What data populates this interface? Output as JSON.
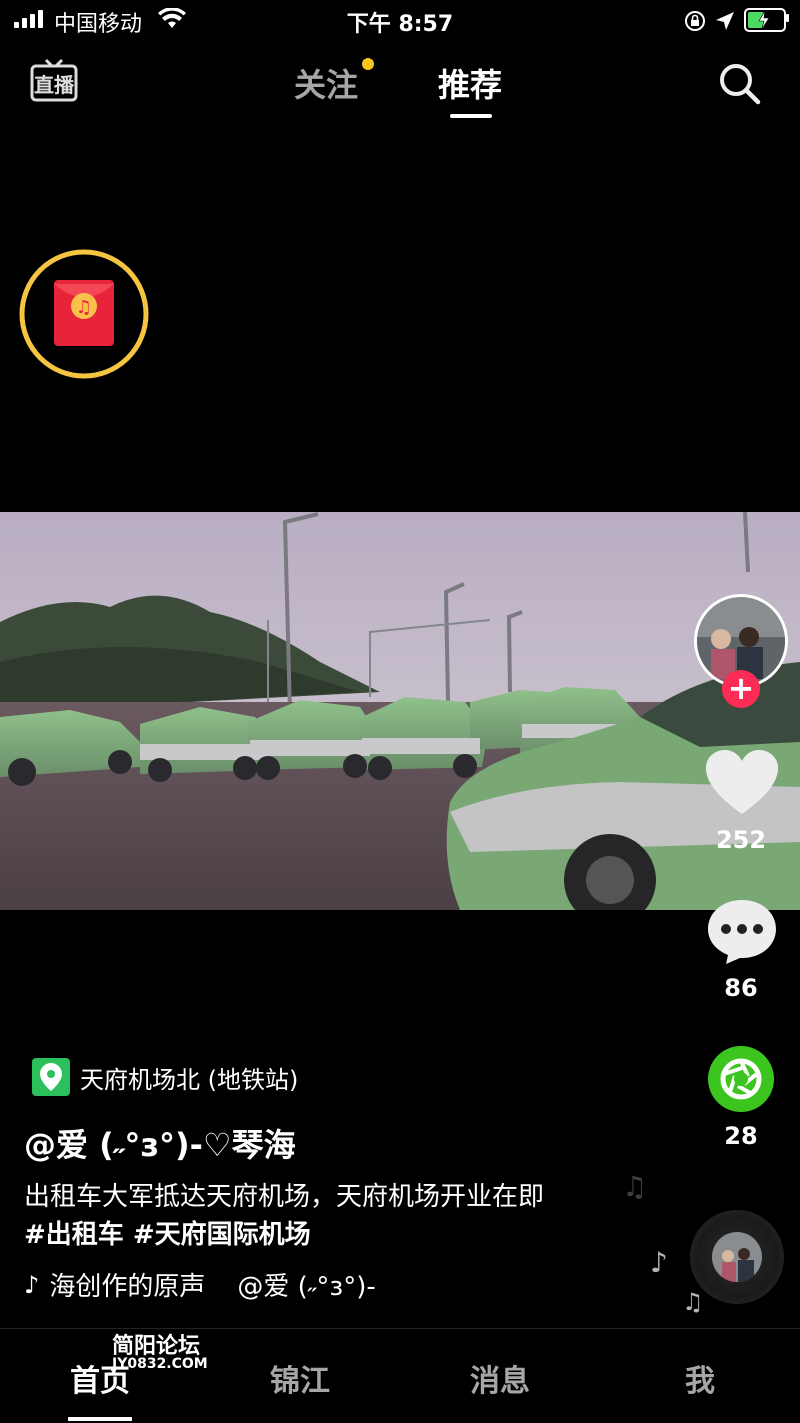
{
  "status_bar": {
    "carrier": "中国移动",
    "time": "下午 8:57",
    "battery_level": 0.5
  },
  "top_nav": {
    "live_label": "直播",
    "tabs": [
      {
        "label": "关注",
        "has_dot": true
      },
      {
        "label": "推荐",
        "selected": true
      }
    ],
    "icons": {
      "search": "search-icon"
    }
  },
  "red_packet": {
    "icon": "music-note-icon",
    "color": "#e8243a",
    "ring_color": "#f5c542"
  },
  "video": {
    "scene": "taxi-fleet"
  },
  "right_rail": {
    "likes": "252",
    "comments": "86",
    "shares": "28",
    "share_color": "#3cc51f",
    "follow_color": "#fe2c55"
  },
  "caption": {
    "location": "天府机场北 (地铁站)",
    "author": "@爱 (˶°з°)-♡琴海",
    "description": "出租车大军抵达天府机场，天府机场开业在即",
    "tags": "#出租车 #天府国际机场",
    "music": "海创作的原声",
    "music_author": "@爱 (˶°з°)-"
  },
  "bottom_nav": {
    "items": [
      "首页",
      "锦江",
      "消息",
      "我"
    ],
    "selected": 0
  },
  "watermark": {
    "title": "简阳论坛",
    "url": "JY0832.COM"
  }
}
